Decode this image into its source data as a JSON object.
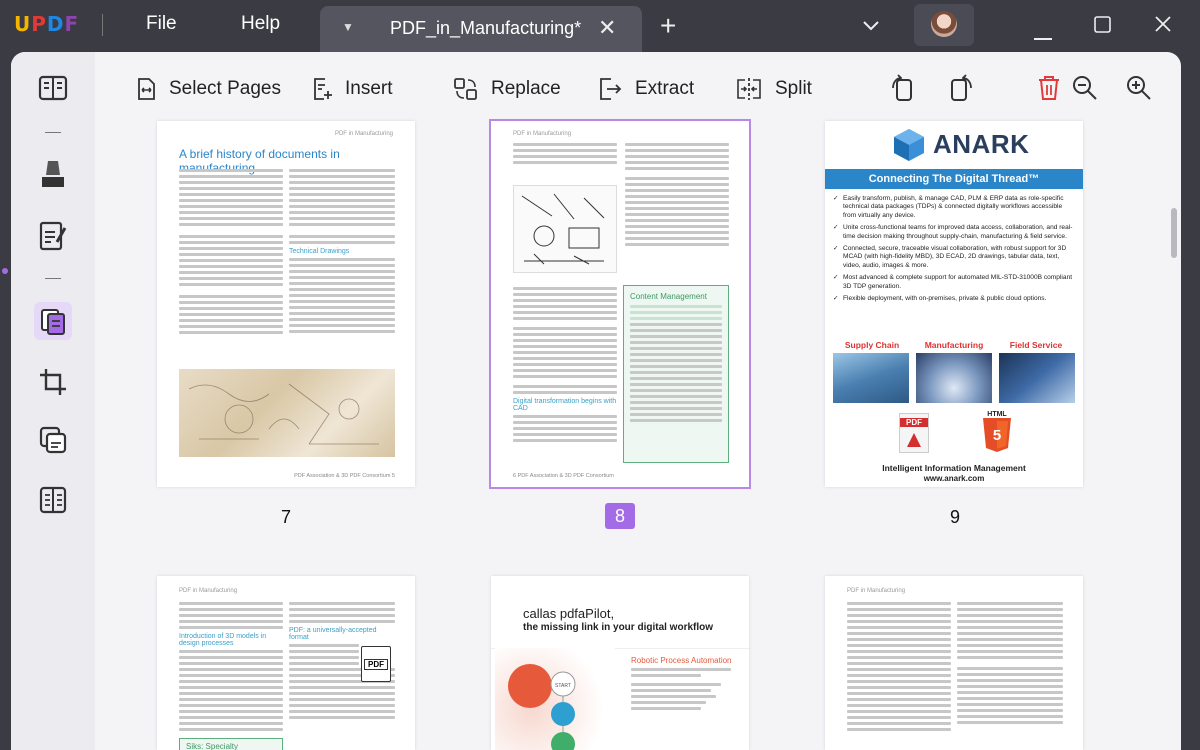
{
  "app": {
    "logo": "UPDF"
  },
  "menu": [
    {
      "label": "File"
    },
    {
      "label": "Help"
    }
  ],
  "tab": {
    "title": "PDF_in_Manufacturing*"
  },
  "toolbar": {
    "select_pages": "Select Pages",
    "insert": "Insert",
    "replace": "Replace",
    "extract": "Extract",
    "split": "Split"
  },
  "pages": [
    {
      "number": "7",
      "header": "PDF in Manufacturing",
      "title": "A brief history of documents in manufacturing",
      "subheading": "Technical Drawings",
      "footer": "PDF Association & 3D PDF Consortium    5"
    },
    {
      "number": "8",
      "header": "PDF in Manufacturing",
      "box_title": "Content Management",
      "subheading": "Digital transformation begins with CAD",
      "footer": "6    PDF Association & 3D PDF Consortium"
    },
    {
      "number": "9",
      "brand": "ANARK",
      "banner": "Connecting The Digital Thread™",
      "bullets": [
        "Easily transform, publish, & manage CAD, PLM & ERP data as role-specific technical data packages (TDPs) & connected digitally workflows accessible from virtually any device.",
        "Unite cross-functional teams for improved data access, collaboration, and real-time decision making throughout supply-chain, manufacturing & field service.",
        "Connected, secure, traceable visual collaboration, with robust support for 3D MCAD (with high-fidelity MBD), 3D ECAD, 2D drawings, tabular data, text, video, audio, images & more.",
        "Most advanced & complete support for automated MIL-STD-31000B compliant 3D TDP generation.",
        "Flexible deployment, with on-premises, private & public cloud options."
      ],
      "columns": [
        "Supply Chain",
        "Manufacturing",
        "Field Service"
      ],
      "pdf_label": "PDF",
      "html_label": "HTML",
      "tagline": "Intelligent Information Management",
      "url": "www.anark.com"
    },
    {
      "header": "PDF in Manufacturing",
      "subheading": "Introduction of 3D models in design processes",
      "subheading2": "PDF: a universally-accepted format",
      "box_title": "Siks: Specialty Chemicals"
    },
    {
      "brand_line1": "callas pdfaPilot,",
      "brand_line2": "the missing link in your digital workflow",
      "rpa_title": "Robotic Process Automation",
      "start": "START"
    },
    {
      "header": "PDF in Manufacturing"
    }
  ],
  "colors": {
    "accent": "#a46be6",
    "brand": "#2a86c9",
    "delete": "#e03b3b"
  }
}
